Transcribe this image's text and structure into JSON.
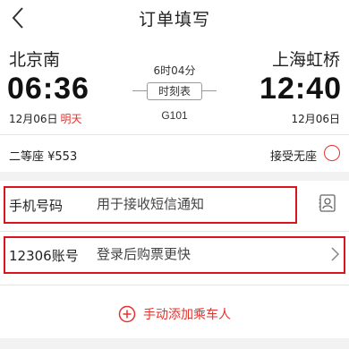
{
  "header": {
    "title": "订单填写"
  },
  "train": {
    "from_station": "北京南",
    "to_station": "上海虹桥",
    "depart_time": "06:36",
    "arrive_time": "12:40",
    "depart_date": "12月06日",
    "depart_date_tag": "明天",
    "arrive_date": "12月06日",
    "duration": "6时04分",
    "timetable_label": "时刻表",
    "train_number": "G101"
  },
  "seat": {
    "type_and_price": "二等座 ¥553",
    "accept_no_seat_label": "接受无座"
  },
  "form": {
    "phone_label": "手机号码",
    "phone_placeholder": "用于接收短信通知",
    "account_label": "12306账号",
    "account_placeholder": "登录后购票更快"
  },
  "add_passenger": {
    "label": "手动添加乘车人"
  },
  "colors": {
    "accent": "#e5322d",
    "highlight_border": "#d9141e"
  }
}
